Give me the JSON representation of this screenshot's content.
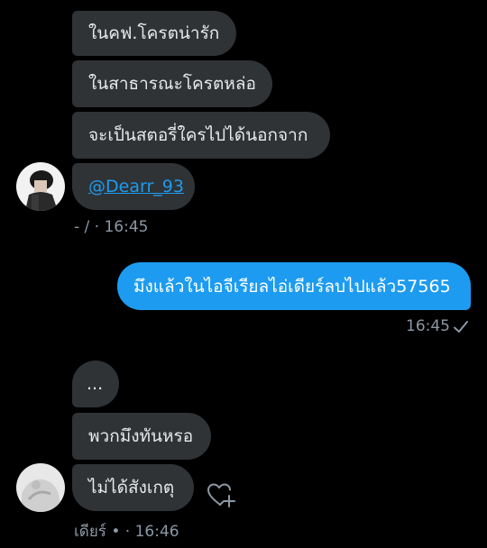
{
  "conversation": {
    "group1": {
      "messages": [
        "ในคฟ.โครตน่ารัก",
        "ในสาธารณะโครตหล่อ",
        "จะเป็นสตอรี่ใครไปได้นอกจาก"
      ],
      "mention": "@Dearr_93",
      "meta": "- / · 16:45"
    },
    "outgoing": {
      "message": "มึงแล้วในไอจีเรียลไอ่เดียร์ลบไปแล้ว57565",
      "time": "16:45",
      "status_icon": "check-icon"
    },
    "group2": {
      "messages": [
        "...",
        "พวกมึงทันหรอ",
        "ไม่ได้สังเกตุ"
      ],
      "meta": "เดียร์ • · 16:46",
      "reaction_icon": "heart-add-icon"
    }
  },
  "colors": {
    "background": "#000000",
    "incoming_bubble": "#2f3336",
    "outgoing_bubble": "#1d9bf0",
    "meta_text": "#8b98a5",
    "link": "#1d9bf0"
  }
}
